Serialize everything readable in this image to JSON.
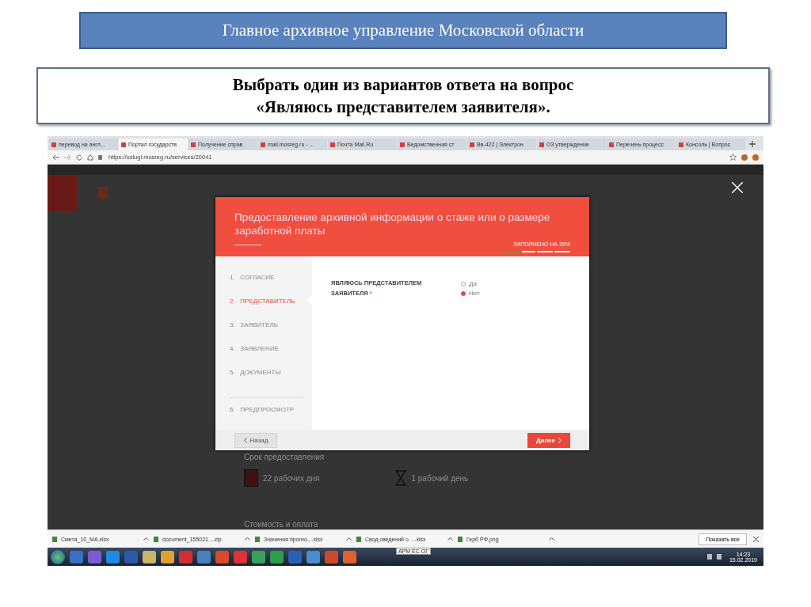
{
  "slide": {
    "title": "Главное архивное управление Московской области",
    "heading": "Выбрать один из вариантов ответа на вопрос «Являюсь представителем заявителя»."
  },
  "browser": {
    "tabs": [
      {
        "label": "перевод на англ...",
        "selected": false
      },
      {
        "label": "Портал государств",
        "selected": true
      },
      {
        "label": "Получение справ",
        "selected": false
      },
      {
        "label": "mail.mosreg.ru - ...",
        "selected": false
      },
      {
        "label": "Почта Mail.Ru",
        "selected": false
      },
      {
        "label": "Ведомственная ст",
        "selected": false
      },
      {
        "label": "Вв-422 | Электрон",
        "selected": false
      },
      {
        "label": "О3 утверждении",
        "selected": false
      },
      {
        "label": "Перечень процесс",
        "selected": false
      },
      {
        "label": "Консоль | Вопрос",
        "selected": false
      }
    ],
    "address": "https://uslugi.mosreg.ru/services/20041"
  },
  "modal": {
    "title": "Предоставление архивной информации о стаже или о размере заработной платы",
    "progress_label": "ЗАПОЛНЕНО НА 29%",
    "level": 0.29,
    "steps": [
      {
        "number": "1.",
        "label": "СОГЛАСИЕ",
        "selected": false
      },
      {
        "number": "2.",
        "label": "ПРЕДСТАВИТЕЛЬ",
        "selected": true
      },
      {
        "number": "3.",
        "label": "ЗАЯВИТЕЛЬ",
        "selected": false
      },
      {
        "number": "4.",
        "label": "ЗАЯВЛЕНИЕ",
        "selected": false
      },
      {
        "number": "5.",
        "label": "ДОКУМЕНТЫ",
        "selected": false
      },
      {
        "number": "6.",
        "label": "ПРЕДПРОСМОТР",
        "selected": false
      }
    ],
    "question": "ЯВЛЯЮСЬ ПРЕДСТАВИТЕЛЕМ ЗАЯВИТЕЛЯ",
    "required_mark": "*",
    "options": [
      {
        "label": "Да",
        "selected": false
      },
      {
        "label": "Нет",
        "selected": true
      }
    ],
    "back_button": "Назад",
    "next_button": "Далее"
  },
  "background_page": {
    "section_title": "Срок предоставления",
    "term_1": "22 рабочих дня",
    "term_2": "1 рабочий день",
    "section_2_title": "Стоимость и оплата"
  },
  "downloads": {
    "files": [
      "Смета_10_МА.xlsx",
      "document_155021....zip",
      "Значения прогно....xlsx",
      "Свод сведений о ....xlsx",
      "Герб РФ.png"
    ],
    "show_all": "Показать все"
  },
  "taskbar": {
    "tooltip": "АРМ ЕС ОГ",
    "time": "14:23",
    "date": "15.02.2019"
  }
}
